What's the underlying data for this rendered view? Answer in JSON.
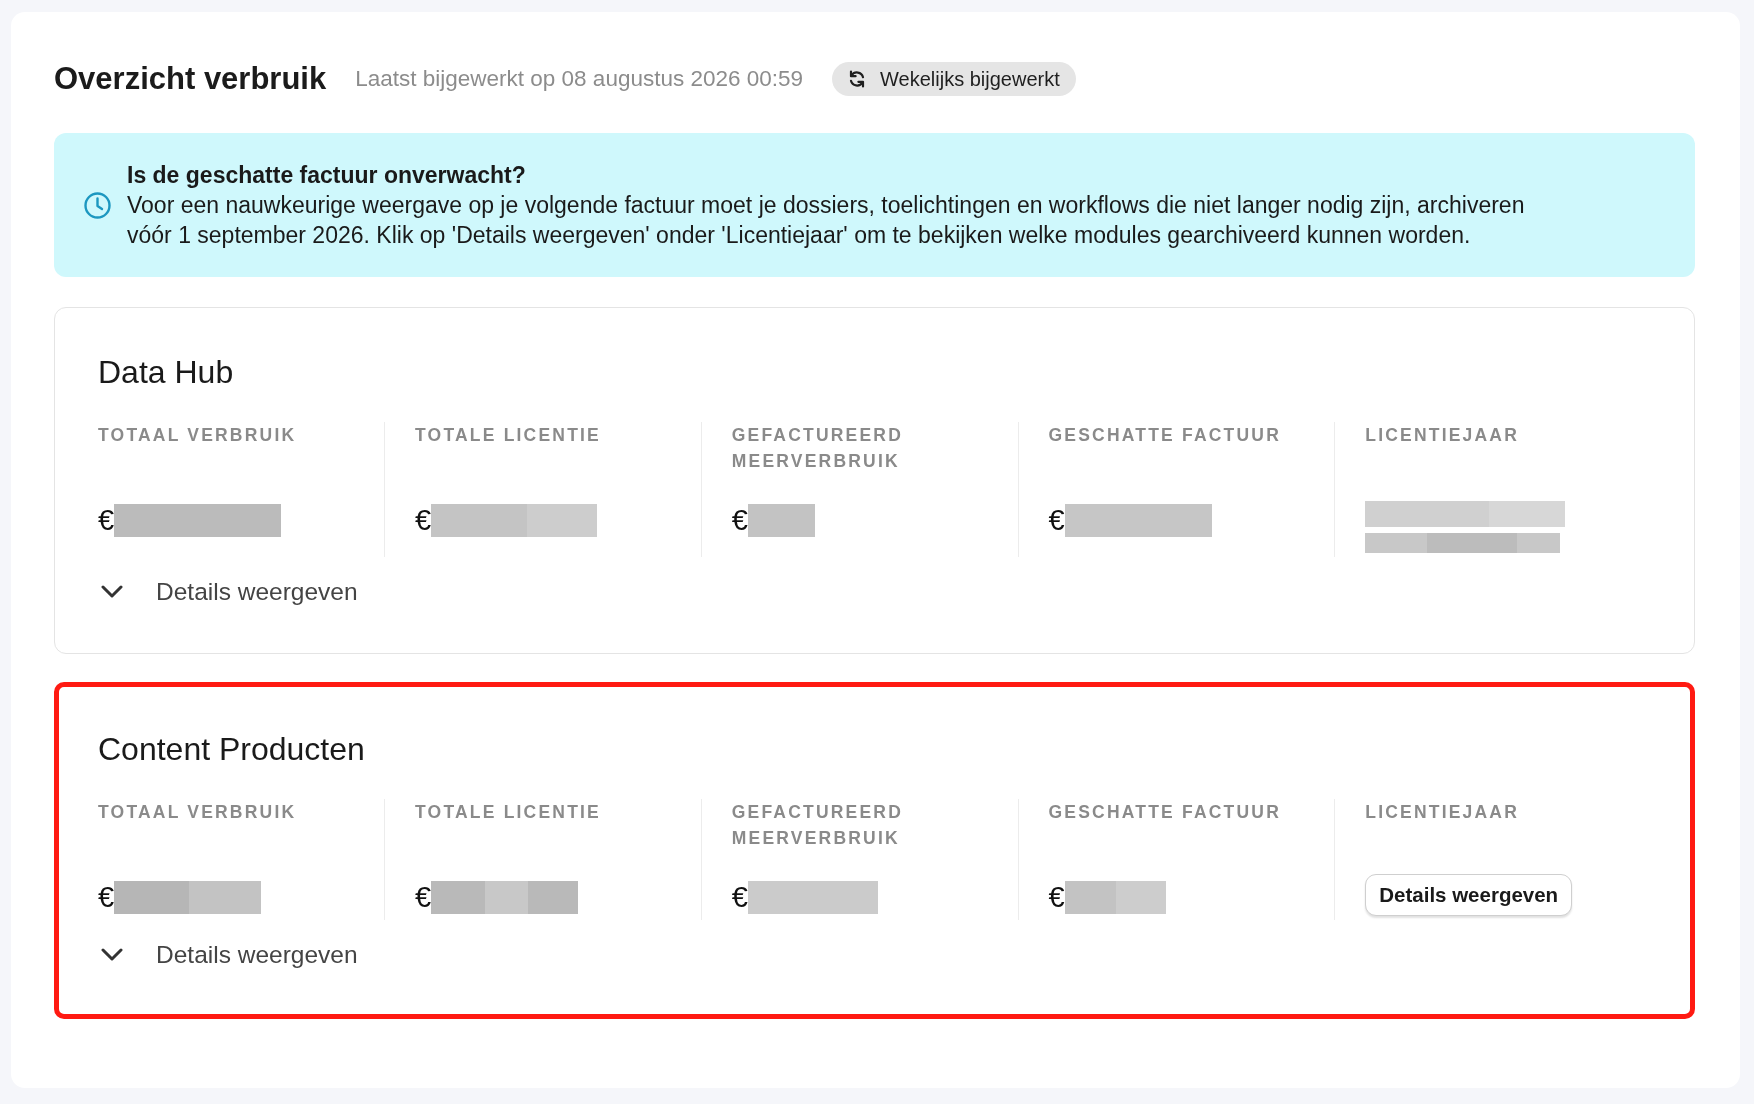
{
  "header": {
    "title": "Overzicht verbruik",
    "updated": "Laatst bijgewerkt op 08 augustus 2026 00:59",
    "badge": "Wekelijks bijgewerkt"
  },
  "alert": {
    "heading": "Is de geschatte factuur onverwacht?",
    "text": "Voor een nauwkeurige weergave op je volgende factuur moet je dossiers, toelichtingen en workflows die niet langer nodig zijn, archiveren vóór 1 september 2026. Klik op 'Details weergeven' onder 'Licentiejaar' om te bekijken welke modules gearchiveerd kunnen worden."
  },
  "cards": [
    {
      "title": "Data Hub",
      "highlighted": false,
      "metrics": [
        {
          "kind": "amount",
          "label": "TOTAAL VERBRUIK",
          "currency": "€",
          "redacted": true
        },
        {
          "kind": "amount",
          "label": "TOTALE LICENTIE",
          "currency": "€",
          "redacted": true
        },
        {
          "kind": "amount",
          "label": "GEFACTUREERD MEERVERBRUIK",
          "currency": "€",
          "redacted": true
        },
        {
          "kind": "amount",
          "label": "GESCHATTE FACTUUR",
          "currency": "€",
          "redacted": true
        },
        {
          "kind": "period",
          "label": "LICENTIEJAAR",
          "redacted": true
        }
      ],
      "details_toggle": {
        "label": "Details weergeven",
        "expanded": false
      }
    },
    {
      "title": "Content Producten",
      "highlighted": true,
      "metrics": [
        {
          "kind": "amount",
          "label": "TOTAAL VERBRUIK",
          "currency": "€",
          "redacted": true
        },
        {
          "kind": "amount",
          "label": "TOTALE LICENTIE",
          "currency": "€",
          "redacted": true
        },
        {
          "kind": "amount",
          "label": "GEFACTUREERD MEERVERBRUIK",
          "currency": "€",
          "redacted": true
        },
        {
          "kind": "amount",
          "label": "GESCHATTE FACTUUR",
          "currency": "€",
          "redacted": true
        },
        {
          "kind": "action",
          "label": "LICENTIEJAAR",
          "button": "Details weergeven"
        }
      ],
      "details_toggle": {
        "label": "Details weergeven",
        "expanded": false
      }
    }
  ]
}
